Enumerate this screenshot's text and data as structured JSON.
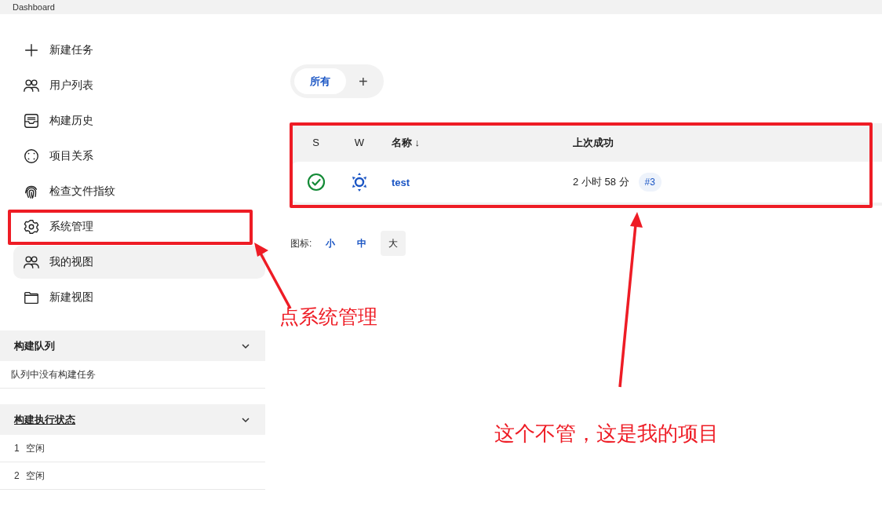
{
  "breadcrumb": {
    "label": "Dashboard"
  },
  "sidebar": {
    "items": [
      {
        "label": "新建任务",
        "kind": "plus",
        "selected": false
      },
      {
        "label": "用户列表",
        "kind": "users",
        "selected": false
      },
      {
        "label": "构建历史",
        "kind": "inbox",
        "selected": false
      },
      {
        "label": "项目关系",
        "kind": "relation",
        "selected": false
      },
      {
        "label": "检查文件指纹",
        "kind": "fingerprint",
        "selected": false
      },
      {
        "label": "系统管理",
        "kind": "gear",
        "selected": false
      },
      {
        "label": "我的视图",
        "kind": "users",
        "selected": true
      },
      {
        "label": "新建视图",
        "kind": "folder",
        "selected": false
      }
    ]
  },
  "build_queue": {
    "title": "构建队列",
    "expanded": true,
    "message": "队列中没有构建任务"
  },
  "executors": {
    "title": "构建执行状态",
    "expanded": true,
    "rows": [
      {
        "number": "1",
        "status": "空闲"
      },
      {
        "number": "2",
        "status": "空闲"
      }
    ]
  },
  "tabs": [
    {
      "label": "所有",
      "selected": true
    }
  ],
  "add_tab": {
    "label": "+"
  },
  "table": {
    "columns": [
      "S",
      "W",
      "名称 ↓",
      "上次成功"
    ],
    "rows": [
      {
        "kind": "success",
        "name": "test",
        "last_success": "2 小时 58 分",
        "build": "#3"
      }
    ]
  },
  "icon_size": {
    "label": "图标:",
    "options": [
      {
        "label": "小",
        "selected": false
      },
      {
        "label": "中",
        "selected": false
      },
      {
        "label": "大",
        "selected": true
      }
    ]
  },
  "annotations": [
    {
      "text": "点系统管理"
    },
    {
      "text": "这个不管，这是我的项目"
    }
  ]
}
